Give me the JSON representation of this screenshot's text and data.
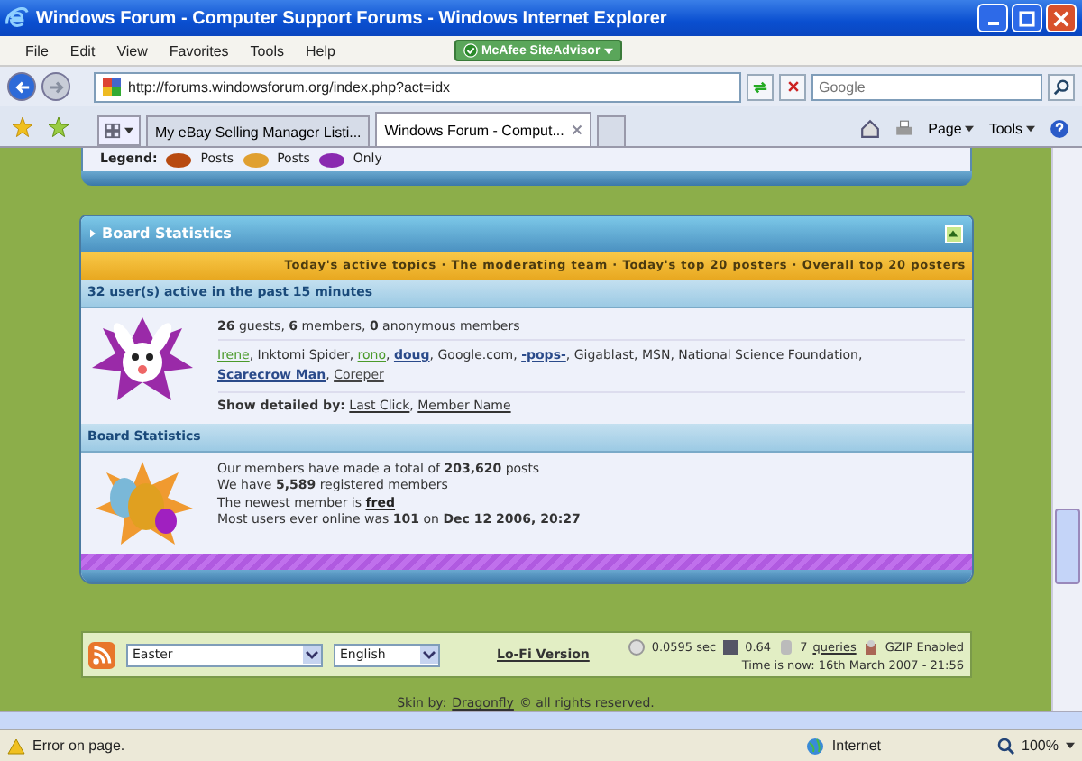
{
  "window": {
    "title": "Windows Forum - Computer Support Forums - Windows Internet Explorer"
  },
  "menu": [
    "File",
    "Edit",
    "View",
    "Favorites",
    "Tools",
    "Help"
  ],
  "siteadvisor": {
    "label": "McAfee SiteAdvisor"
  },
  "address": {
    "value": "http://forums.windowsforum.org/index.php?act=idx"
  },
  "search": {
    "placeholder": "Google"
  },
  "tabs": [
    {
      "label": "My eBay Selling Manager Listi...",
      "selected": false
    },
    {
      "label": "Windows Forum - Comput...",
      "selected": true
    }
  ],
  "command_bar": [
    "Page",
    "Tools"
  ],
  "legend": {
    "label": "Legend:",
    "items": [
      "Posts",
      "Posts",
      "Only"
    ]
  },
  "board_statistics": {
    "title": "Board Statistics",
    "expanded": true,
    "link_separator": " · ",
    "list_separator": ", ",
    "links": [
      "Today's active topics",
      "The moderating team",
      "Today's top 20 posters",
      "Overall top 20 posters"
    ],
    "active_header": "32 user(s) active in the past 15 minutes",
    "summary": "**26** guests, **6** members, **0** anonymous members",
    "users": [
      {
        "name": "Irene",
        "kind": "member",
        "color": "#4a9a2a"
      },
      {
        "name": "Inktomi Spider",
        "kind": "bot"
      },
      {
        "name": "rono",
        "kind": "member",
        "color": "#4a9a2a"
      },
      {
        "name": "doug",
        "kind": "admin",
        "color": "#2a4a8a"
      },
      {
        "name": "Google.com",
        "kind": "bot"
      },
      {
        "name": "-pops-",
        "kind": "admin",
        "color": "#2a4a8a"
      },
      {
        "name": "Gigablast",
        "kind": "bot"
      },
      {
        "name": "MSN",
        "kind": "bot"
      },
      {
        "name": "National Science Foundation",
        "kind": "bot"
      },
      {
        "name": "Scarecrow Man",
        "kind": "admin",
        "color": "#2a4a8a"
      },
      {
        "name": "Coreper",
        "kind": "member",
        "color": "#444444"
      }
    ],
    "detail_label": "Show detailed by:",
    "detail_links": [
      "Last Click",
      "Member Name"
    ],
    "stats_header": "Board Statistics",
    "stats": [
      "Our members have made a total of **203,620** posts",
      "We have **5,589** registered members"
    ],
    "newest_label": "The newest member is",
    "newest_member": "fred",
    "record": "Most users ever online was **101** on **Dec 12 2006, 20:27**"
  },
  "footer": {
    "skin": "Easter",
    "language": "English",
    "lofi": "Lo-Fi Version",
    "time_taken": "0.0595 sec",
    "load": "0.64",
    "queries_count": "7",
    "queries_link": "queries",
    "gzip": "GZIP Enabled",
    "time_now": "Time is now: 16th March 2007 - 21:56"
  },
  "credit": {
    "label": "Skin by:",
    "link": "Dragonfly",
    "rest": "© all rights reserved."
  },
  "status_bar": {
    "message": "Error on page.",
    "zone": "Internet",
    "zoom": "100%"
  }
}
